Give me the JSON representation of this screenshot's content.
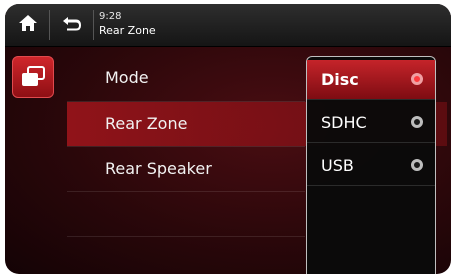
{
  "status": {
    "time": "9:28"
  },
  "header": {
    "title": "Rear Zone"
  },
  "icons": {
    "home": "home-icon",
    "back": "back-icon",
    "source": "source-switch-icon"
  },
  "menu": {
    "items": [
      {
        "label": "Mode",
        "selected": false
      },
      {
        "label": "Rear Zone",
        "selected": true
      },
      {
        "label": "Rear Speaker",
        "selected": false
      }
    ]
  },
  "popup": {
    "options": [
      {
        "label": "Disc",
        "selected": true
      },
      {
        "label": "SDHC",
        "selected": false
      },
      {
        "label": "USB",
        "selected": false
      }
    ]
  },
  "colors": {
    "accent": "#c5242a",
    "background": "#2a070a"
  }
}
